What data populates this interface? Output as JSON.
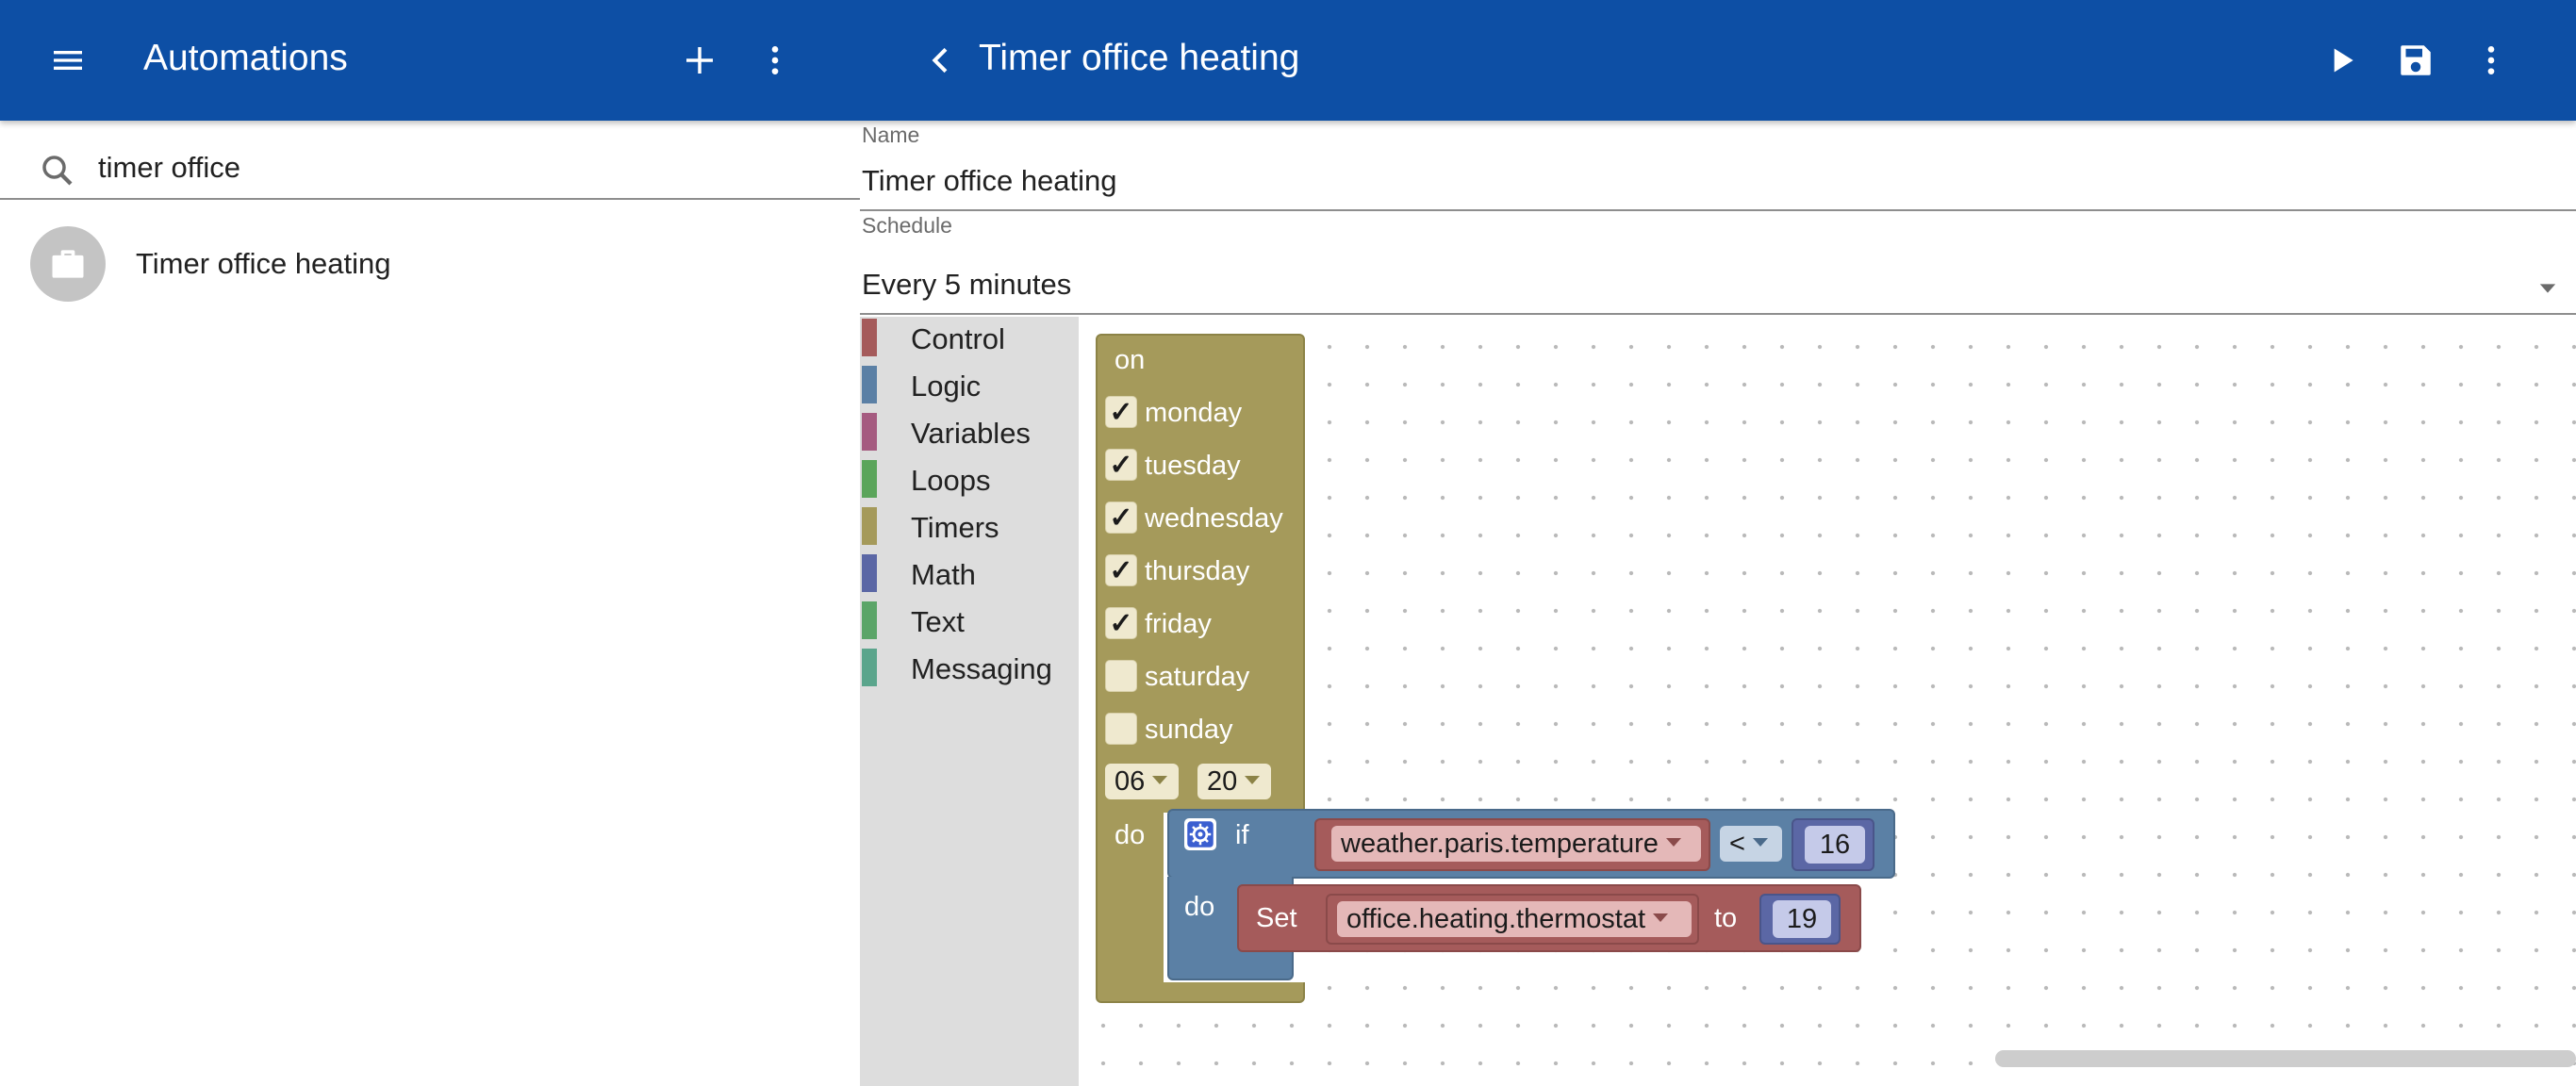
{
  "colors": {
    "app_bar": "#0d4fa5",
    "control": "#a55b5b",
    "logic": "#5b80a5",
    "variables": "#a55b80",
    "loops": "#5ba55b",
    "timers": "#a59a5b",
    "math": "#5b67a5",
    "text": "#5ba568",
    "messaging": "#5ba58c"
  },
  "left_header": {
    "menu_icon": "menu-icon",
    "title": "Automations",
    "add_icon": "add-icon",
    "more_icon": "more-vert-icon"
  },
  "search": {
    "icon": "search-icon",
    "value": "timer office"
  },
  "automation_list": [
    {
      "label": "Timer office heating",
      "icon": "briefcase-icon"
    }
  ],
  "editor_header": {
    "back_icon": "chevron-left-icon",
    "title": "Timer office heating",
    "run_icon": "play-icon",
    "save_icon": "save-icon",
    "more_icon": "more-vert-icon"
  },
  "form": {
    "name_label": "Name",
    "name_value": "Timer office heating",
    "schedule_label": "Schedule",
    "schedule_value": "Every 5 minutes"
  },
  "toolbox": {
    "categories": [
      {
        "label": "Control",
        "color": "#a55b5b"
      },
      {
        "label": "Logic",
        "color": "#5b80a5"
      },
      {
        "label": "Variables",
        "color": "#a55b80"
      },
      {
        "label": "Loops",
        "color": "#5ba55b"
      },
      {
        "label": "Timers",
        "color": "#a59a5b"
      },
      {
        "label": "Math",
        "color": "#5b67a5"
      },
      {
        "label": "Text",
        "color": "#5ba568"
      },
      {
        "label": "Messaging",
        "color": "#5ba58c"
      }
    ]
  },
  "timer_block": {
    "on_label": "on",
    "days": [
      {
        "label": "monday",
        "checked": true
      },
      {
        "label": "tuesday",
        "checked": true
      },
      {
        "label": "wednesday",
        "checked": true
      },
      {
        "label": "thursday",
        "checked": true
      },
      {
        "label": "friday",
        "checked": true
      },
      {
        "label": "saturday",
        "checked": false
      },
      {
        "label": "sunday",
        "checked": false
      }
    ],
    "check_mark": "✓",
    "hour": "06",
    "minute": "20",
    "do_label": "do"
  },
  "if_block": {
    "gear_icon": "gear-icon",
    "if_label": "if",
    "do_label": "do",
    "variable": "weather.paris.temperature",
    "operator": "<",
    "value": "16"
  },
  "set_block": {
    "set_label": "Set",
    "variable": "office.heating.thermostat",
    "to_label": "to",
    "value": "19"
  }
}
